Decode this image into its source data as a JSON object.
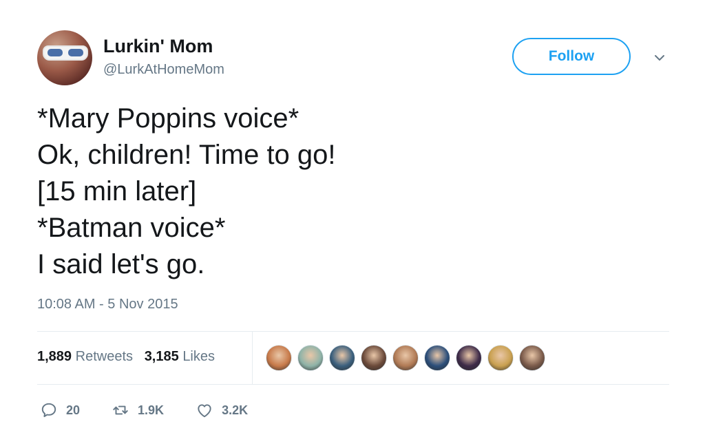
{
  "user": {
    "display_name": "Lurkin' Mom",
    "handle": "@LurkAtHomeMom"
  },
  "follow_label": "Follow",
  "tweet": {
    "lines": [
      "*Mary Poppins voice*",
      "Ok, children! Time to go!",
      "[15 min later]",
      "*Batman voice*",
      "I said let's go."
    ],
    "timestamp": "10:08 AM - 5 Nov 2015"
  },
  "stats": {
    "retweets_count": "1,889",
    "retweets_label": "Retweets",
    "likes_count": "3,185",
    "likes_label": "Likes"
  },
  "likers": [
    {
      "icon": "avatar",
      "color": "#c77a4a"
    },
    {
      "icon": "avatar",
      "color": "#8fb3a8"
    },
    {
      "icon": "avatar",
      "color": "#3a5f7d"
    },
    {
      "icon": "avatar",
      "color": "#6b4a3a"
    },
    {
      "icon": "avatar",
      "color": "#b07a55"
    },
    {
      "icon": "avatar",
      "color": "#2b4e7a"
    },
    {
      "icon": "avatar",
      "color": "#3d2a48"
    },
    {
      "icon": "avatar",
      "color": "#c9a050"
    },
    {
      "icon": "avatar",
      "color": "#7a5a4a"
    }
  ],
  "actions": {
    "reply_icon": "reply-icon",
    "reply_count": "20",
    "retweet_icon": "retweet-icon",
    "retweet_count": "1.9K",
    "like_icon": "heart-icon",
    "like_count": "3.2K"
  },
  "colors": {
    "accent": "#1da1f2",
    "secondary_text": "#657786",
    "divider": "#e6ecf0"
  }
}
